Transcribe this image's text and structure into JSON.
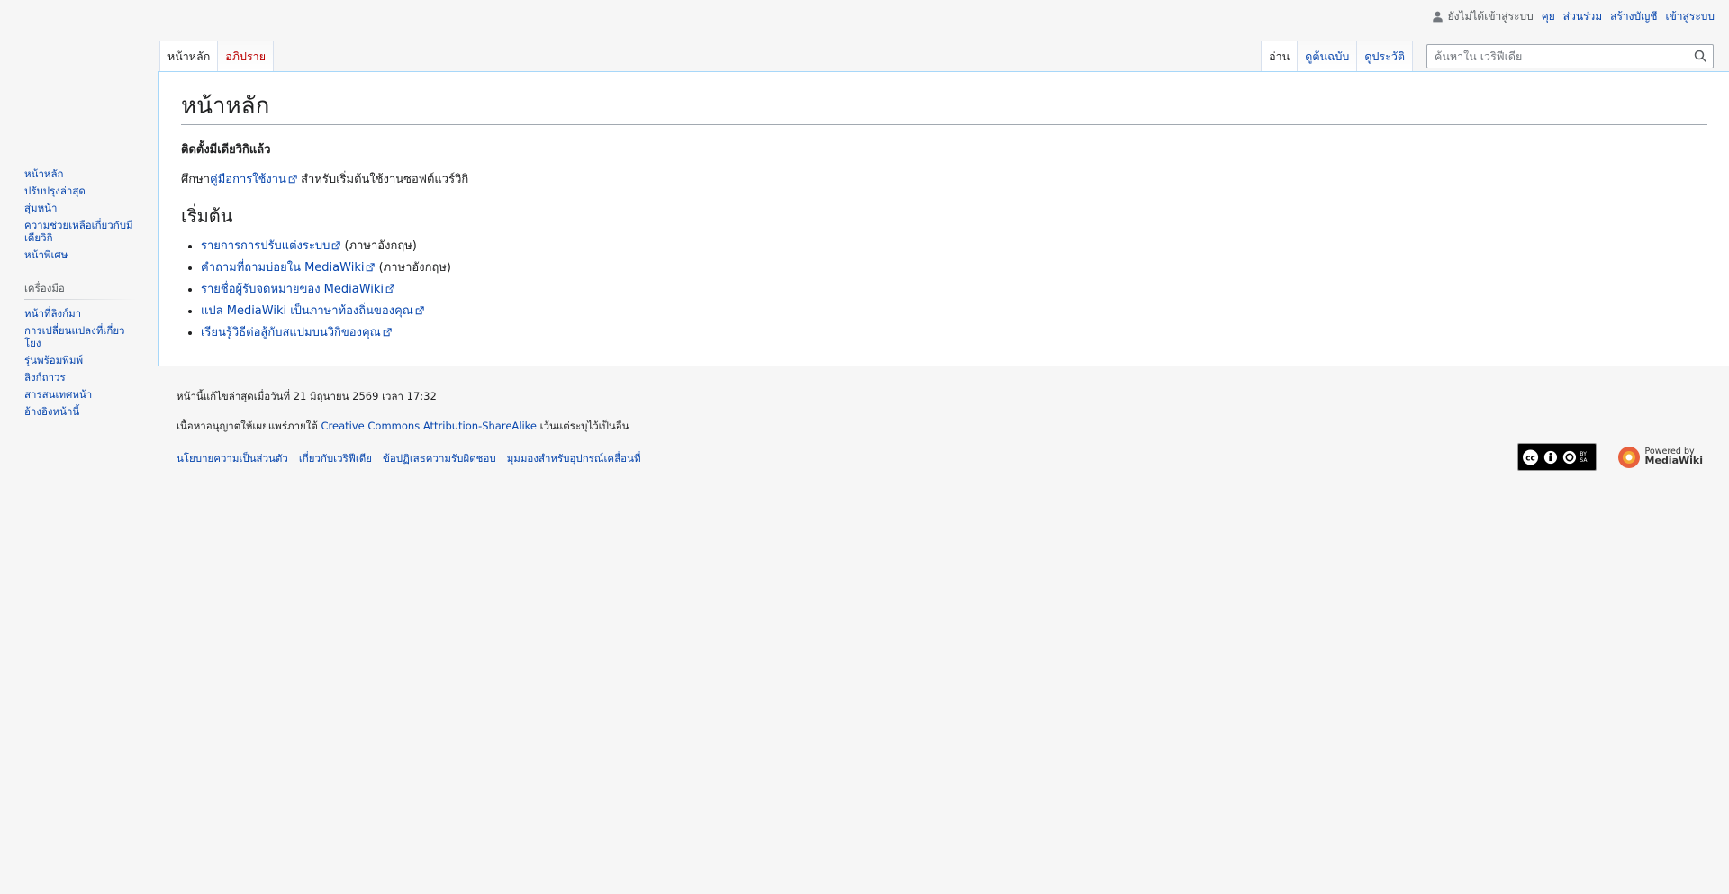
{
  "personal": {
    "anon_label": "ยังไม่ได้เข้าสู่ระบบ",
    "links": [
      "คุย",
      "ส่วนร่วม",
      "สร้างบัญชี",
      "เข้าสู่ระบบ"
    ]
  },
  "tabs_left": [
    {
      "label": "หน้าหลัก",
      "selected": true
    },
    {
      "label": "อภิปราย",
      "selected": false
    }
  ],
  "tabs_right": [
    {
      "label": "อ่าน",
      "selected": true
    },
    {
      "label": "ดูต้นฉบับ",
      "selected": false
    },
    {
      "label": "ดูประวัติ",
      "selected": false
    }
  ],
  "search": {
    "placeholder": "ค้นหาใน เวริฟีเดีย",
    "value": ""
  },
  "article": {
    "title": "หน้าหลัก",
    "installed": "ติดตั้งมีเดียวิกิแล้ว",
    "intro_prefix": "ศึกษา",
    "intro_link": "คู่มือการใช้งาน",
    "intro_suffix": " สำหรับเริ่มต้นใช้งานซอฟต์แวร์วิกิ",
    "section_title": "เริ่มต้น",
    "items": [
      {
        "link": "รายการการปรับแต่งระบบ",
        "suffix": " (ภาษาอังกฤษ)"
      },
      {
        "link": "คำถามที่ถามบ่อยใน MediaWiki",
        "suffix": " (ภาษาอังกฤษ)"
      },
      {
        "link": "รายชื่อผู้รับจดหมายของ MediaWiki",
        "suffix": ""
      },
      {
        "link": "แปล MediaWiki เป็นภาษาท้องถิ่นของคุณ",
        "suffix": ""
      },
      {
        "link": "เรียนรู้วิธีต่อสู้กับสแปมบนวิกิของคุณ",
        "suffix": ""
      }
    ]
  },
  "sidebar": {
    "nav": [
      "หน้าหลัก",
      "ปรับปรุงล่าสุด",
      "สุ่มหน้า",
      "ความช่วยเหลือเกี่ยวกับมีเดียวิกิ",
      "หน้าพิเศษ"
    ],
    "tools_heading": "เครื่องมือ",
    "tools": [
      "หน้าที่ลิงก์มา",
      "การเปลี่ยนแปลงที่เกี่ยวโยง",
      "รุ่นพร้อมพิมพ์",
      "ลิงก์ถาวร",
      "สารสนเทศหน้า",
      "อ้างอิงหน้านี้"
    ]
  },
  "footer": {
    "lastmod": "หน้านี้แก้ไขล่าสุดเมื่อวันที่ 21 มิถุนายน 2569 เวลา 17:32",
    "license_prefix": "เนื้อหาอนุญาตให้เผยแพร่ภายใต้ ",
    "license_link": "Creative Commons Attribution-ShareAlike",
    "license_suffix": " เว้นแต่ระบุไว้เป็นอื่น",
    "links": [
      "นโยบายความเป็นส่วนตัว",
      "เกี่ยวกับเวริฟีเดีย",
      "ข้อปฏิเสธความรับผิดชอบ",
      "มุมมองสำหรับอุปกรณ์เคลื่อนที่"
    ],
    "cc_badge_text": "BY SA",
    "powered_by": "Powered by",
    "powered_name": "MediaWiki"
  }
}
